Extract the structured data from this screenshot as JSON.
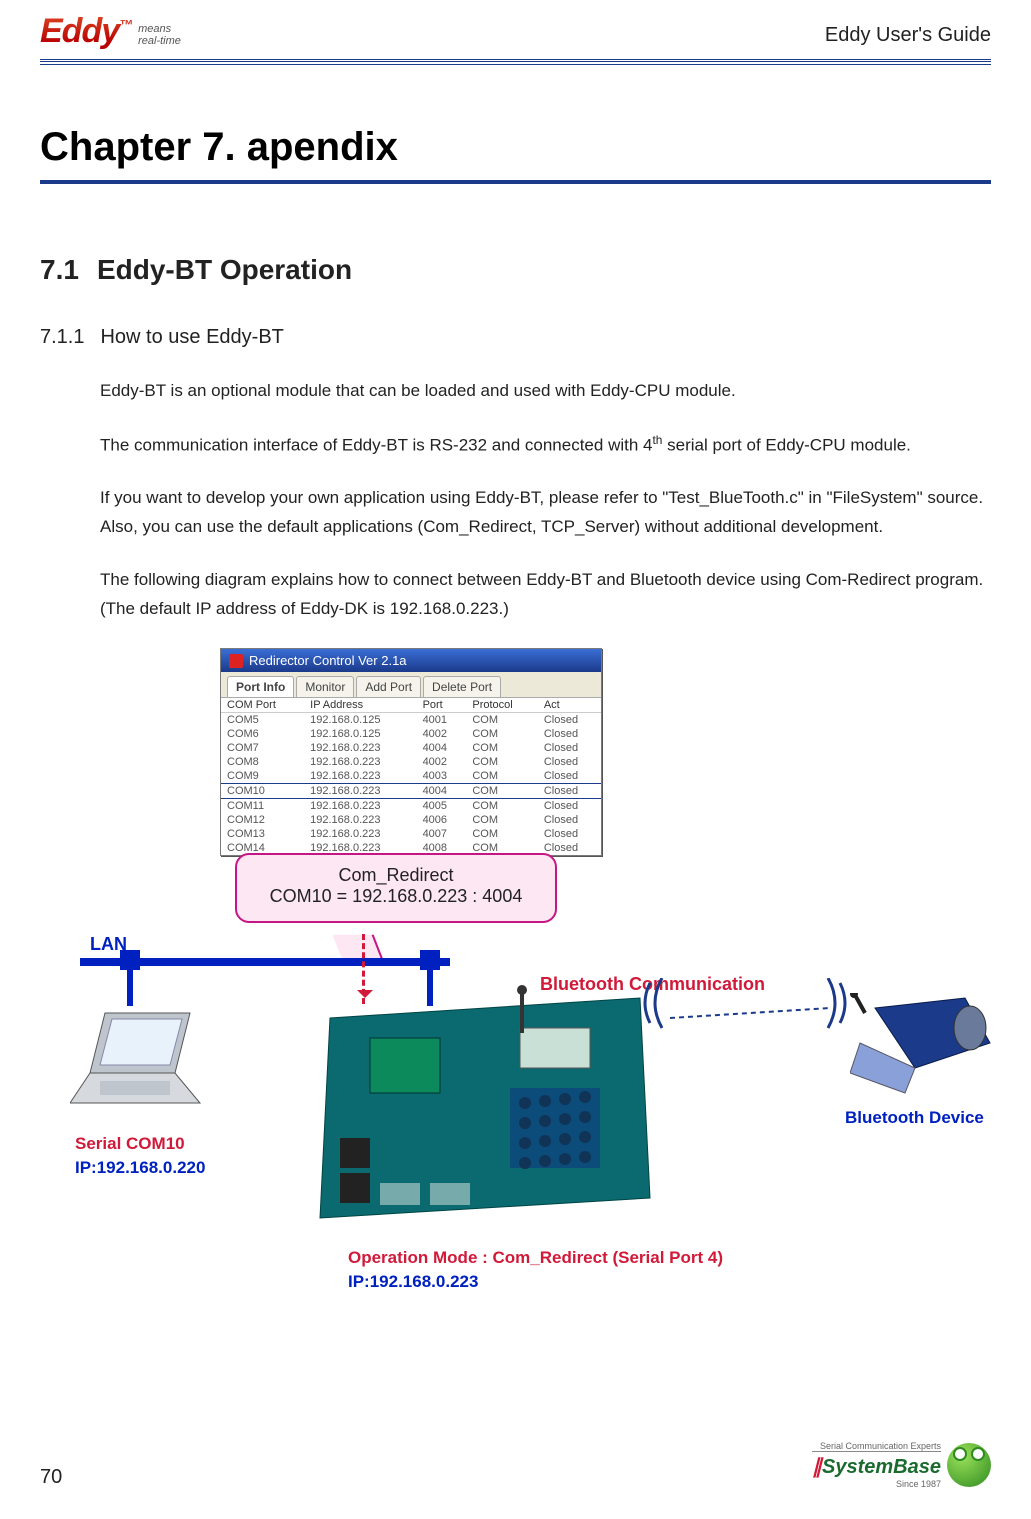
{
  "header": {
    "logo_main": "Eddy",
    "logo_tm": "™",
    "logo_sub1": "means",
    "logo_sub2": "real-time",
    "doc_title": "Eddy User's Guide"
  },
  "chapter": {
    "title": "Chapter 7.    apendix"
  },
  "section": {
    "number": "7.1",
    "title": "Eddy-BT Operation"
  },
  "subsection": {
    "number": "7.1.1",
    "title": "How to use Eddy-BT"
  },
  "paragraphs": {
    "p1": "Eddy-BT is an optional module that can be loaded and used with Eddy-CPU module.",
    "p2_pre": "The communication interface of Eddy-BT is RS-232 and connected with 4",
    "p2_sup": "th",
    "p2_post": " serial port of Eddy-CPU module.",
    "p3": "If you want to develop your own application using Eddy-BT, please refer to  \"Test_BlueTooth.c\"  in  \"FileSystem\"  source. Also, you can use the default applications (Com_Redirect, TCP_Server) without additional development.",
    "p4": "The following diagram explains how to connect between Eddy-BT and Bluetooth device using Com-Redirect program. (The default IP address of Eddy-DK is 192.168.0.223.)"
  },
  "diagram": {
    "redirector_title": "Redirector Control Ver 2.1a",
    "tabs": {
      "active": "Port Info",
      "others": [
        "Monitor",
        "Add Port",
        "Delete Port"
      ]
    },
    "columns": [
      "COM Port",
      "IP Address",
      "Port",
      "Protocol",
      "Act"
    ],
    "rows": [
      {
        "com": "COM5",
        "ip": "192.168.0.125",
        "port": "4001",
        "proto": "COM",
        "act": "Closed"
      },
      {
        "com": "COM6",
        "ip": "192.168.0.125",
        "port": "4002",
        "proto": "COM",
        "act": "Closed"
      },
      {
        "com": "COM7",
        "ip": "192.168.0.223",
        "port": "4004",
        "proto": "COM",
        "act": "Closed"
      },
      {
        "com": "COM8",
        "ip": "192.168.0.223",
        "port": "4002",
        "proto": "COM",
        "act": "Closed"
      },
      {
        "com": "COM9",
        "ip": "192.168.0.223",
        "port": "4003",
        "proto": "COM",
        "act": "Closed"
      },
      {
        "com": "COM10",
        "ip": "192.168.0.223",
        "port": "4004",
        "proto": "COM",
        "act": "Closed"
      },
      {
        "com": "COM11",
        "ip": "192.168.0.223",
        "port": "4005",
        "proto": "COM",
        "act": "Closed"
      },
      {
        "com": "COM12",
        "ip": "192.168.0.223",
        "port": "4006",
        "proto": "COM",
        "act": "Closed"
      },
      {
        "com": "COM13",
        "ip": "192.168.0.223",
        "port": "4007",
        "proto": "COM",
        "act": "Closed"
      },
      {
        "com": "COM14",
        "ip": "192.168.0.223",
        "port": "4008",
        "proto": "COM",
        "act": "Closed"
      }
    ],
    "callout_line1": "Com_Redirect",
    "callout_line2": "COM10 = 192.168.0.223 : 4004",
    "lan_label": "LAN",
    "laptop_label1": "Serial COM10",
    "laptop_label2": "IP:192.168.0.220",
    "bt_comm_label": "Bluetooth Communication",
    "bt_device_label": "Bluetooth Device",
    "op_mode_label": "Operation Mode : Com_Redirect (Serial Port 4)",
    "op_ip_label": "IP:192.168.0.223"
  },
  "footer": {
    "page_number": "70",
    "company_tag": "Serial Communication Experts",
    "company_name": "SystemBase",
    "company_since": "Since 1987"
  }
}
